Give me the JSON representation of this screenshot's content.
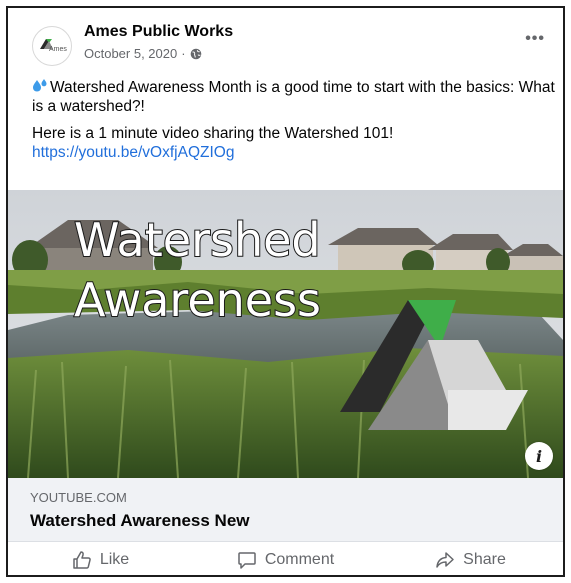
{
  "post": {
    "author": "Ames Public Works",
    "date": "October 5, 2020",
    "separator": "·",
    "more_label": "•••",
    "avatar_text": "Ames",
    "text_line1": "Watershed Awareness Month is a good time to start with the basics: What is a watershed?!",
    "text_line2_prefix": "Here is a 1 minute video sharing the Watershed 101! ",
    "link_url": "https://youtu.be/vOxfjAQZIOg"
  },
  "media": {
    "overlay_title_line1": "Watershed",
    "overlay_title_line2": "Awareness",
    "info_label": "i"
  },
  "link_preview": {
    "domain": "YOUTUBE.COM",
    "title": "Watershed Awareness New"
  },
  "actions": {
    "like": "Like",
    "comment": "Comment",
    "share": "Share"
  },
  "colors": {
    "link": "#216fdb",
    "secondary_text": "#65676b",
    "logo_green": "#3fae49",
    "logo_dark": "#2b2b2b",
    "logo_gray": "#8a8a8a"
  }
}
